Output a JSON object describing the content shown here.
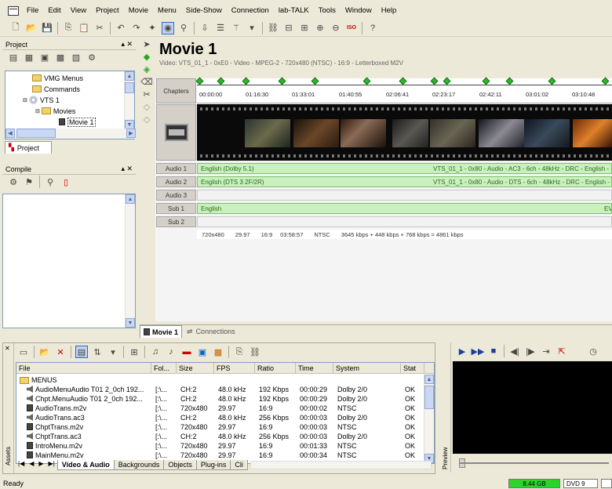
{
  "menu": [
    "File",
    "Edit",
    "View",
    "Project",
    "Movie",
    "Menu",
    "Side-Show",
    "Connection",
    "lab-TALK",
    "Tools",
    "Window",
    "Help"
  ],
  "project_panel": {
    "title": "Project",
    "tab": "Project",
    "tree": [
      "VMG Menus",
      "Commands",
      "VTS 1",
      "Movies",
      "Movie 1"
    ]
  },
  "compile_panel": {
    "title": "Compile"
  },
  "movie": {
    "title": "Movie 1",
    "subtitle": "Video: VTS_01_1 - 0xE0 - Video - MPEG-2 - 720x480 (NTSC) - 16:9 - Letterboxed M2V"
  },
  "tracks": {
    "chapters_label": "Chapters",
    "chapter_times": [
      "00:00:00",
      "01:16:30",
      "01:33:01",
      "01:40:55",
      "02:06:41",
      "02:23:17",
      "02:42:11",
      "03:01:02",
      "03:10:48"
    ],
    "audio1_label": "Audio 1",
    "audio1_left": "English (Dolby 5.1)",
    "audio1_right": "VTS_01_1 - 0x80 - Audio - AC3 - 6ch - 48kHz - DRC - English -",
    "audio2_label": "Audio 2",
    "audio2_left": "English (DTS 3 2F/2R)",
    "audio2_right": "VTS_01_1 - 0x80 - Audio - DTS - 6ch - 48kHz - DRC - English -",
    "audio3_label": "Audio 3",
    "sub1_label": "Sub 1",
    "sub1_left": "English",
    "sub1_right": "EV",
    "sub2_label": "Sub 2",
    "info": {
      "res": "720x480",
      "fps": "29.97",
      "ratio": "16:9",
      "dur": "03:58:57",
      "std": "NTSC",
      "bitrate": "3645 kbps + 448 kbps + 768 kbps = 4861 kbps"
    }
  },
  "movie_tabs": [
    "Movie 1",
    "Connections"
  ],
  "assets": {
    "side_label": "Assets",
    "columns": [
      "File",
      "Fol...",
      "Size",
      "FPS",
      "Ratio",
      "Time",
      "System",
      "Stat"
    ],
    "folder": "MENUS",
    "rows": [
      {
        "file": "AudioMenuAudio T01 2_0ch 192...",
        "fol": "[:\\...",
        "size": "CH:2",
        "fps": "48.0 kHz",
        "ratio": "192 Kbps",
        "time": "00:00:29",
        "system": "Dolby 2/0",
        "stat": "OK",
        "kind": "audio"
      },
      {
        "file": "Chpt.MenuAudio T01 2_0ch 192...",
        "fol": "[:\\...",
        "size": "CH:2",
        "fps": "48.0 kHz",
        "ratio": "192 Kbps",
        "time": "00:00:29",
        "system": "Dolby 2/0",
        "stat": "OK",
        "kind": "audio"
      },
      {
        "file": "AudioTrans.m2v",
        "fol": "[:\\...",
        "size": "720x480",
        "fps": "29.97",
        "ratio": "16:9",
        "time": "00:00:02",
        "system": "NTSC",
        "stat": "OK",
        "kind": "video"
      },
      {
        "file": "AudioTrans.ac3",
        "fol": "[:\\...",
        "size": "CH:2",
        "fps": "48.0 kHz",
        "ratio": "256 Kbps",
        "time": "00:00:03",
        "system": "Dolby 2/0",
        "stat": "OK",
        "kind": "audio"
      },
      {
        "file": "ChptTrans.m2v",
        "fol": "[:\\...",
        "size": "720x480",
        "fps": "29.97",
        "ratio": "16:9",
        "time": "00:00:03",
        "system": "NTSC",
        "stat": "OK",
        "kind": "video"
      },
      {
        "file": "ChptTrans.ac3",
        "fol": "[:\\...",
        "size": "CH:2",
        "fps": "48.0 kHz",
        "ratio": "256 Kbps",
        "time": "00:00:03",
        "system": "Dolby 2/0",
        "stat": "OK",
        "kind": "audio"
      },
      {
        "file": "IntroMenu.m2v",
        "fol": "[:\\...",
        "size": "720x480",
        "fps": "29.97",
        "ratio": "16:9",
        "time": "00:01:33",
        "system": "NTSC",
        "stat": "OK",
        "kind": "video"
      },
      {
        "file": "MainMenu.m2v",
        "fol": "[:\\...",
        "size": "720x480",
        "fps": "29.97",
        "ratio": "16:9",
        "time": "00:00:34",
        "system": "NTSC",
        "stat": "OK",
        "kind": "video"
      }
    ],
    "tabs": [
      "Video & Audio",
      "Backgrounds",
      "Objects",
      "Plug-ins",
      "Cli"
    ]
  },
  "preview": {
    "label": "Preview"
  },
  "status": {
    "text": "Ready",
    "disk": "8.44 GB",
    "dvd": "DVD 9"
  }
}
